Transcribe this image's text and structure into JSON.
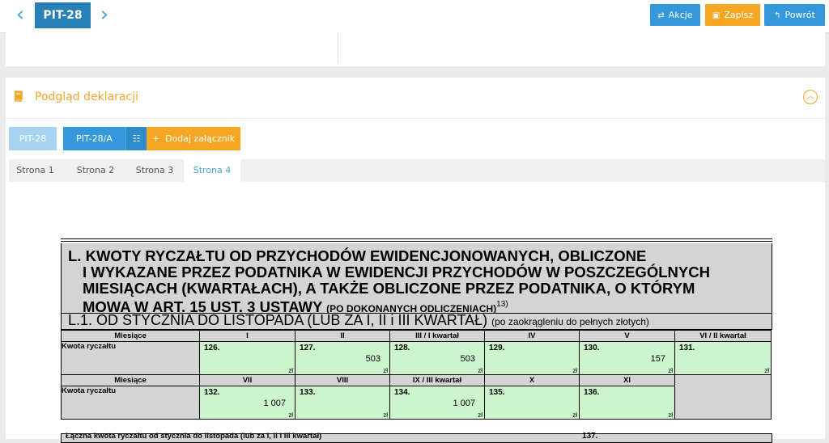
{
  "header": {
    "doc_code": "PIT-28",
    "prev_icon": "chevron-left-icon",
    "next_icon": "chevron-right-icon",
    "buttons": [
      {
        "label": "Akcje",
        "icon": "actions-icon",
        "color": "#3498db"
      },
      {
        "label": "Zapisz",
        "icon": "save-icon",
        "color": "#f5a623"
      },
      {
        "label": "Powrót",
        "icon": "back-icon",
        "color": "#3498db"
      }
    ]
  },
  "preview": {
    "title": "Podgląd deklaracji",
    "title_icon": "book-icon",
    "collapse_icon": "chevron-up-circle-icon",
    "form_buttons": [
      {
        "label": "PIT-28"
      },
      {
        "label": "PIT-28/A"
      },
      {
        "label": "",
        "icon": "list-icon"
      },
      {
        "label": "Dodaj załącznik",
        "icon": "plus-icon"
      }
    ],
    "tabs": [
      "Strona 1",
      "Strona 2",
      "Strona 3",
      "Strona 4"
    ],
    "active_tab": "Strona 4"
  },
  "form": {
    "section_title_1": "L. KWOTY RYCZAŁTU OD PRZYCHODÓW EWIDENCJONOWANYCH, OBLICZONE",
    "section_title_2": "I WYKAZANE PRZEZ PODATNIKA W EWIDENCJI PRZYCHODÓW W POSZCZEGÓLNYCH",
    "section_title_3": "MIESIĄCACH (KWARTAŁACH), A TAKŻE OBLICZONE PRZEZ PODATNIKA, O KTÓRYM",
    "section_title_4": "MOWA W ART. 15 UST. 3 USTAWY",
    "section_title_small": "(PO DOKONANYCH ODLICZENIACH)",
    "section_title_sup": "13)",
    "subsection_title": "L.1. OD STYCZNIA DO LISTOPADA (LUB ZA I, II i III KWARTAŁ)",
    "subsection_note": "(po zaokrągleniu do pełnych złotych)",
    "row_header_months": "Miesiące",
    "row_header_amount": "Kwota ryczałtu",
    "months_1": [
      "I",
      "II",
      "III / I kwartał",
      "IV",
      "V",
      "VI / II kwartał"
    ],
    "months_2": [
      "VII",
      "VIII",
      "IX / III kwartał",
      "X",
      "XI"
    ],
    "fields_1": [
      {
        "num": "126.",
        "value": ""
      },
      {
        "num": "127.",
        "value": "503"
      },
      {
        "num": "128.",
        "value": "503"
      },
      {
        "num": "129.",
        "value": ""
      },
      {
        "num": "130.",
        "value": "157"
      },
      {
        "num": "131.",
        "value": ""
      }
    ],
    "fields_2": [
      {
        "num": "132.",
        "value": "1 007"
      },
      {
        "num": "133.",
        "value": ""
      },
      {
        "num": "134.",
        "value": "1 007"
      },
      {
        "num": "135.",
        "value": ""
      },
      {
        "num": "136.",
        "value": ""
      }
    ],
    "currency": "zł",
    "total_label": "Łączna kwota ryczałtu od stycznia do listopada (lub za I, II i III kwartał)",
    "total_num": "137."
  }
}
